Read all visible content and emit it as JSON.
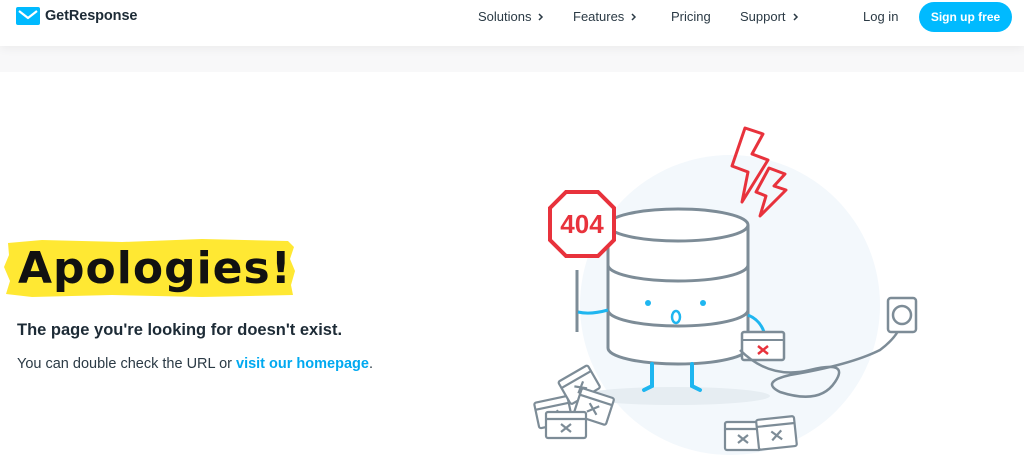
{
  "header": {
    "logo_text": "GetResponse",
    "nav": [
      {
        "label": "Solutions",
        "has_chevron": true
      },
      {
        "label": "Features",
        "has_chevron": true
      },
      {
        "label": "Pricing",
        "has_chevron": false
      },
      {
        "label": "Support",
        "has_chevron": true
      }
    ],
    "login_label": "Log in",
    "signup_label": "Sign up free"
  },
  "content": {
    "headline": "Apologies!",
    "subtitle": "The page you're looking for doesn't exist.",
    "body_prefix": "You can double check the URL or ",
    "body_link": "visit our homepage",
    "body_suffix": "."
  },
  "illustration": {
    "sign_text": "404"
  },
  "colors": {
    "accent": "#00baff",
    "link": "#00a9f0",
    "highlight": "#ffe833",
    "sign_red": "#e8323c",
    "stroke_gray": "#7d8c97",
    "foot_blue": "#1fb6f0"
  }
}
